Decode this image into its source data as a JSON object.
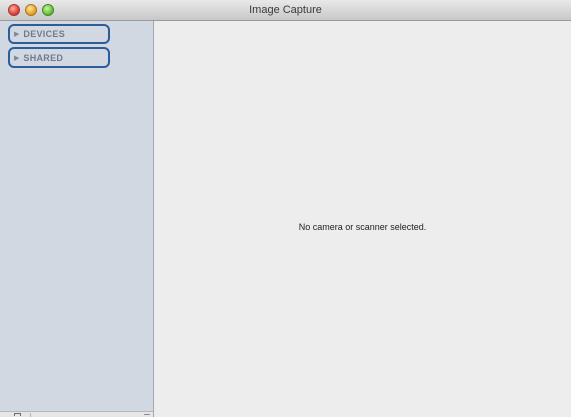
{
  "window": {
    "title": "Image Capture"
  },
  "titlebar": {
    "buttons": [
      {
        "name": "close",
        "color": "#e0443a"
      },
      {
        "name": "minimize",
        "color": "#e9a52a"
      },
      {
        "name": "zoom",
        "color": "#6cc23c"
      }
    ]
  },
  "sidebar": {
    "background": "#d1d8e2",
    "highlight_color": "#2d5c9a",
    "sections": [
      {
        "label": "DEVICES",
        "icon": "disclosure-triangle-icon",
        "expanded": false
      },
      {
        "label": "SHARED",
        "icon": "disclosure-triangle-icon",
        "expanded": false
      }
    ],
    "disclosure_glyph": "▶"
  },
  "main": {
    "empty_message": "No camera or scanner selected."
  }
}
